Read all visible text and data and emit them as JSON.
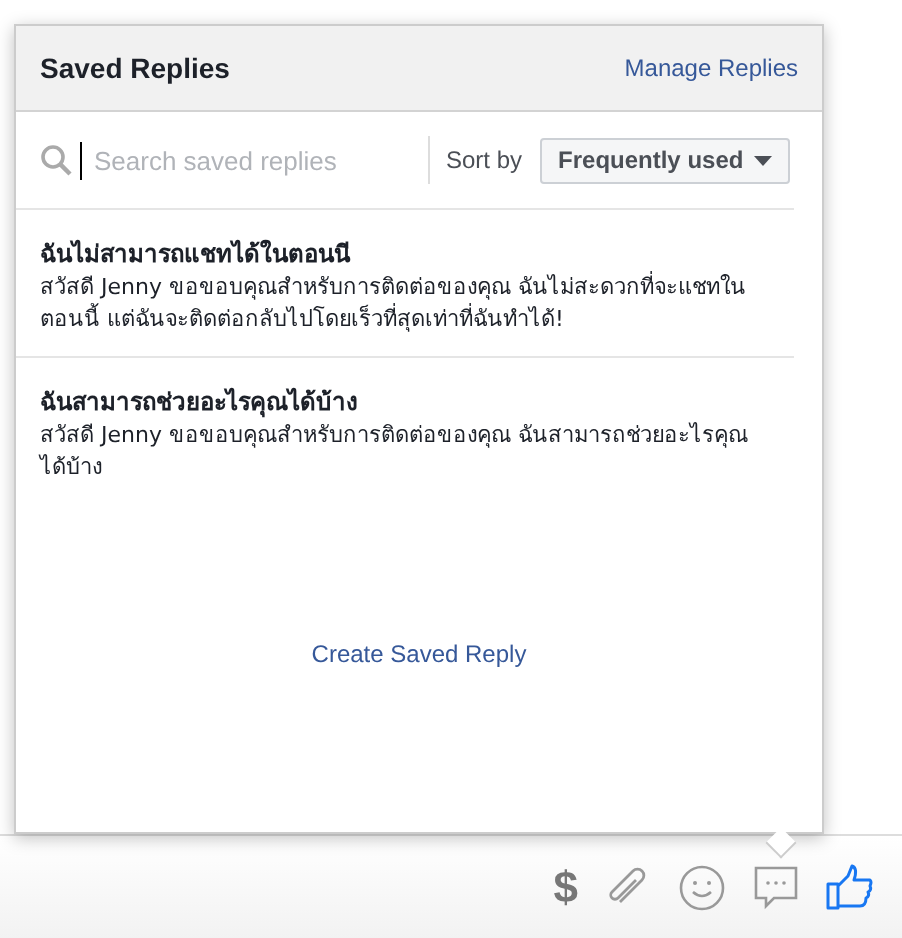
{
  "popup": {
    "title": "Saved Replies",
    "manage_link": "Manage Replies",
    "search": {
      "placeholder": "Search saved replies"
    },
    "sort": {
      "label": "Sort by",
      "value": "Frequently used"
    },
    "replies": [
      {
        "title": "ฉันไม่สามารถแชทได้ในตอนนี",
        "text": "สวัสดี Jenny ขอขอบคุณสำหรับการติดต่อของคุณ ฉันไม่สะดวกที่จะแชทในตอนนี้ แต่ฉันจะติดต่อกลับไปโดยเร็วที่สุดเท่าที่ฉันทำได้!"
      },
      {
        "title": "ฉันสามารถช่วยอะไรคุณได้บ้าง",
        "text": "สวัสดี Jenny ขอขอบคุณสำหรับการติดต่อของคุณ ฉันสามารถช่วยอะไรคุณได้บ้าง"
      }
    ],
    "create_link": "Create Saved Reply"
  },
  "toolbar": {
    "payment_symbol": "$"
  }
}
